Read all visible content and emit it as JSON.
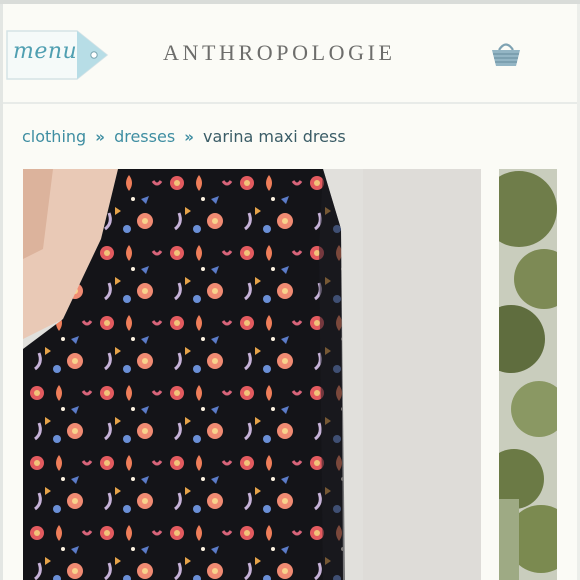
{
  "header": {
    "menu_label": "menu",
    "brand": "ANTHROPOLOGIE",
    "cart_icon": "shopping-basket-icon"
  },
  "breadcrumb": {
    "items": [
      "clothing",
      "dresses"
    ],
    "separator": "»",
    "current": "varina maxi dress"
  },
  "gallery": {
    "main_image": "dress-photo",
    "thumb_image": "outdoor-photo"
  },
  "colors": {
    "accent": "#3f8ea2",
    "tag_blue": "#b7dde6",
    "brand_gray": "#6d6d6b",
    "page_bg": "#fbfbf6"
  }
}
